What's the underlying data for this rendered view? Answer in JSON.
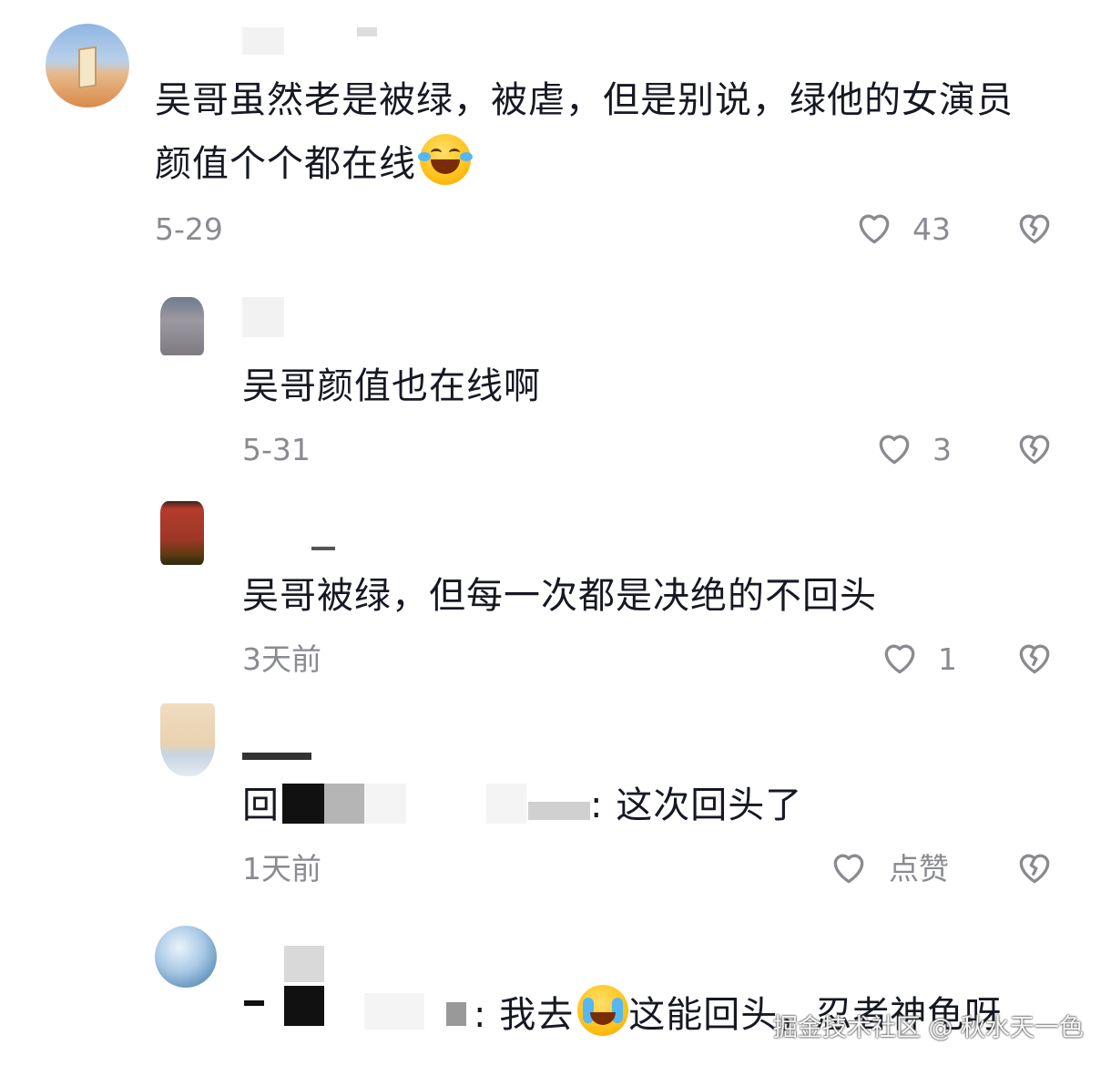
{
  "comments": [
    {
      "text": "吴哥虽然老是被绿，被虐，但是别说，绿他的女演员",
      "text_line2": "颜值个个都在线",
      "emoji": "laughing-tears-emoji",
      "date": "5-29",
      "likes": "43"
    },
    {
      "text": "吴哥颜值也在线啊",
      "date": "5-31",
      "likes": "3"
    },
    {
      "text": "吴哥被绿，但每一次都是决绝的不回头",
      "date": "3天前",
      "likes": "1"
    },
    {
      "prefix": "回",
      "text": ": 这次回头了",
      "date": "1天前",
      "likes": "点赞"
    },
    {
      "text_before_emoji": ": 我去",
      "emoji": "crying-emoji",
      "text_after_emoji": "这能回头，忍者神龟呀"
    }
  ],
  "watermark": "掘金技术社区 @ 秋水天一色",
  "colors": {
    "text": "#161823",
    "meta": "#8a8b91",
    "icon": "#8a8b91"
  }
}
